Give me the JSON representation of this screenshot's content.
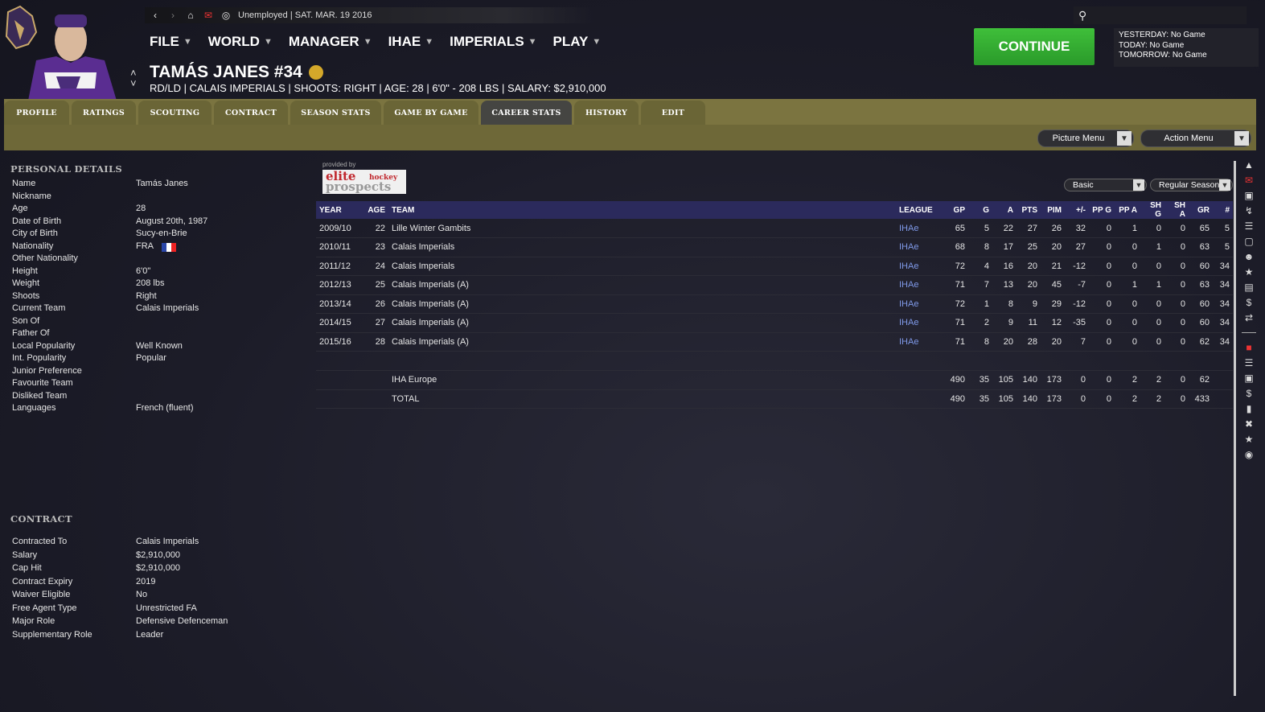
{
  "topbar": {
    "status": "Unemployed | SAT. MAR. 19 2016"
  },
  "menu": [
    {
      "label": "FILE"
    },
    {
      "label": "WORLD"
    },
    {
      "label": "MANAGER"
    },
    {
      "label": "IHAE"
    },
    {
      "label": "IMPERIALS"
    },
    {
      "label": "PLAY"
    }
  ],
  "player": {
    "title": "TAMÁS JANES #34",
    "subtitle": "RD/LD | CALAIS IMPERIALS | SHOOTS: RIGHT | AGE: 28 | 6'0\" - 208 LBS | SALARY: $2,910,000"
  },
  "continue_label": "CONTINUE",
  "schedule": {
    "yesterday": "YESTERDAY: No Game",
    "today": "TODAY: No Game",
    "tomorrow": "TOMORROW: No Game"
  },
  "tabs": [
    "PROFILE",
    "RATINGS",
    "SCOUTING",
    "CONTRACT",
    "SEASON STATS",
    "GAME BY GAME",
    "CAREER STATS",
    "HISTORY",
    "EDIT"
  ],
  "buttons": {
    "picture_menu": "Picture Menu",
    "action_menu": "Action Menu"
  },
  "personal": {
    "title": "PERSONAL DETAILS",
    "rows": [
      {
        "label": "Name",
        "value": "Tamás Janes"
      },
      {
        "label": "Nickname",
        "value": ""
      },
      {
        "label": "Age",
        "value": "28"
      },
      {
        "label": "Date of Birth",
        "value": "August 20th, 1987"
      },
      {
        "label": "City of Birth",
        "value": "Sucy-en-Brie"
      },
      {
        "label": "Nationality",
        "value": "FRA"
      },
      {
        "label": "Other Nationality",
        "value": ""
      },
      {
        "label": "Height",
        "value": "6'0\""
      },
      {
        "label": "Weight",
        "value": "208 lbs"
      },
      {
        "label": "Shoots",
        "value": "Right"
      },
      {
        "label": "Current Team",
        "value": "Calais Imperials"
      },
      {
        "label": "Son Of",
        "value": ""
      },
      {
        "label": "Father Of",
        "value": ""
      },
      {
        "label": "Local Popularity",
        "value": "Well Known"
      },
      {
        "label": "Int. Popularity",
        "value": "Popular"
      },
      {
        "label": "Junior Preference",
        "value": ""
      },
      {
        "label": "Favourite Team",
        "value": ""
      },
      {
        "label": "Disliked Team",
        "value": ""
      },
      {
        "label": "Languages",
        "value": "French (fluent)"
      }
    ]
  },
  "contract": {
    "title": "CONTRACT",
    "rows": [
      {
        "label": "Contracted To",
        "value": "Calais Imperials"
      },
      {
        "label": "Salary",
        "value": "$2,910,000"
      },
      {
        "label": "Cap Hit",
        "value": "$2,910,000"
      },
      {
        "label": "Contract Expiry",
        "value": "2019"
      },
      {
        "label": "Waiver Eligible",
        "value": "No"
      },
      {
        "label": "Free Agent Type",
        "value": "Unrestricted FA"
      },
      {
        "label": "Major Role",
        "value": "Defensive Defenceman"
      },
      {
        "label": "Supplementary Role",
        "value": "Leader"
      }
    ]
  },
  "stats": {
    "provided_by": "provided by",
    "logo_text": [
      "elite",
      "hockey",
      "prospects"
    ],
    "filter_basic": "Basic",
    "filter_season": "Regular Season",
    "headers": [
      "YEAR",
      "AGE",
      "TEAM",
      "LEAGUE",
      "GP",
      "G",
      "A",
      "PTS",
      "PIM",
      "+/-",
      "PP G",
      "PP A",
      "SH G",
      "SH A",
      "GR",
      "#"
    ],
    "rows": [
      [
        "2009/10",
        "22",
        "Lille Winter Gambits",
        "IHAe",
        "65",
        "5",
        "22",
        "27",
        "26",
        "32",
        "0",
        "1",
        "0",
        "0",
        "65",
        "5"
      ],
      [
        "2010/11",
        "23",
        "Calais Imperials",
        "IHAe",
        "68",
        "8",
        "17",
        "25",
        "20",
        "27",
        "0",
        "0",
        "1",
        "0",
        "63",
        "5"
      ],
      [
        "2011/12",
        "24",
        "Calais Imperials",
        "IHAe",
        "72",
        "4",
        "16",
        "20",
        "21",
        "-12",
        "0",
        "0",
        "0",
        "0",
        "60",
        "34"
      ],
      [
        "2012/13",
        "25",
        "Calais Imperials (A)",
        "IHAe",
        "71",
        "7",
        "13",
        "20",
        "45",
        "-7",
        "0",
        "1",
        "1",
        "0",
        "63",
        "34"
      ],
      [
        "2013/14",
        "26",
        "Calais Imperials (A)",
        "IHAe",
        "72",
        "1",
        "8",
        "9",
        "29",
        "-12",
        "0",
        "0",
        "0",
        "0",
        "60",
        "34"
      ],
      [
        "2014/15",
        "27",
        "Calais Imperials (A)",
        "IHAe",
        "71",
        "2",
        "9",
        "11",
        "12",
        "-35",
        "0",
        "0",
        "0",
        "0",
        "60",
        "34"
      ],
      [
        "2015/16",
        "28",
        "Calais Imperials (A)",
        "IHAe",
        "71",
        "8",
        "20",
        "28",
        "20",
        "7",
        "0",
        "0",
        "0",
        "0",
        "62",
        "34"
      ]
    ],
    "totals": [
      [
        "IHA Europe",
        "490",
        "35",
        "105",
        "140",
        "173",
        "0",
        "0",
        "2",
        "2",
        "0",
        "62"
      ],
      [
        "TOTAL",
        "490",
        "35",
        "105",
        "140",
        "173",
        "0",
        "0",
        "2",
        "2",
        "0",
        "433"
      ]
    ]
  },
  "colors": {
    "accent_green": "#3fbf3a",
    "tab_band": "#7b7440",
    "link": "#7f99e8",
    "header_bg": "#2b2a5c"
  }
}
